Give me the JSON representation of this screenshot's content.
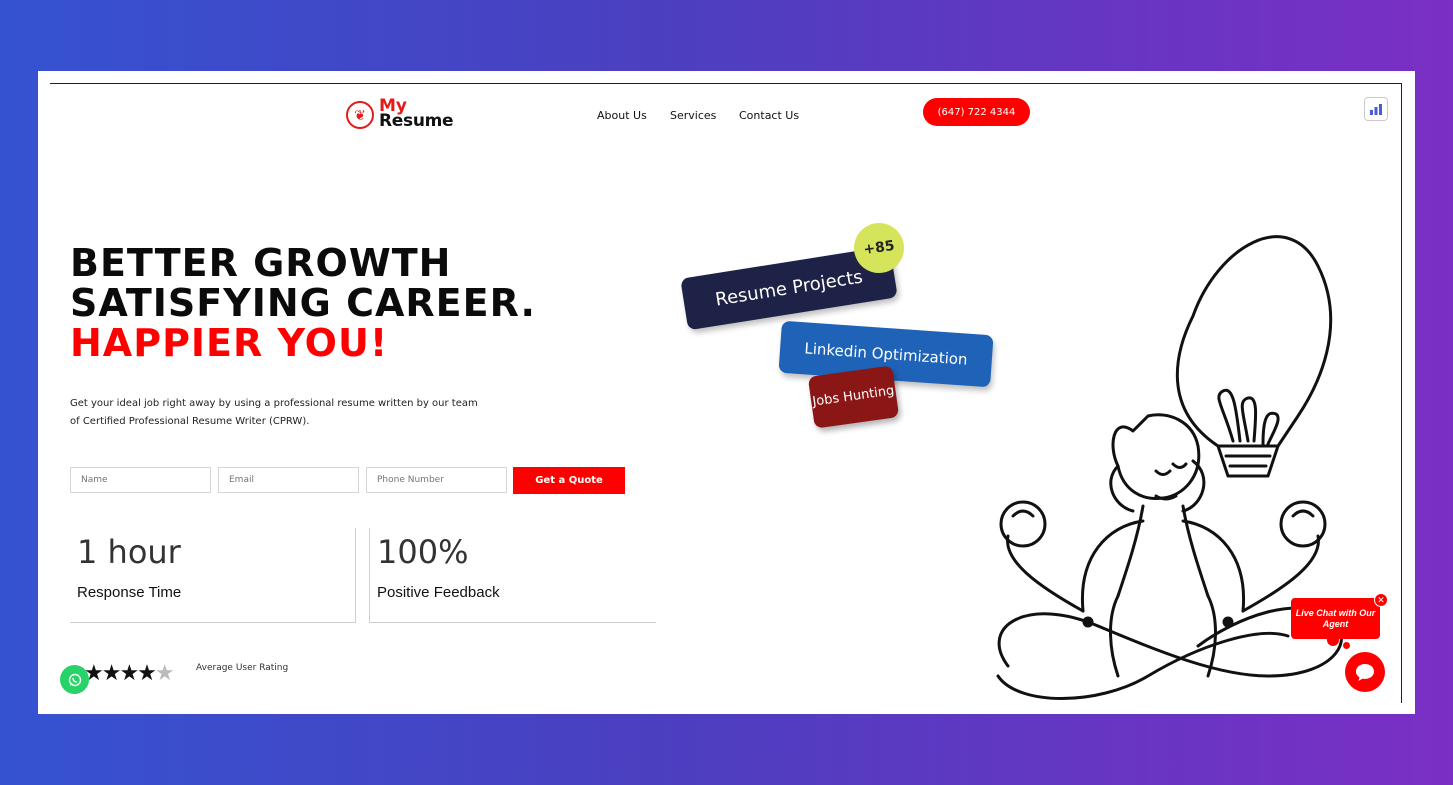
{
  "header": {
    "logo_my": "My",
    "logo_resume": "Resume",
    "nav": [
      "About Us",
      "Services",
      "Contact Us"
    ],
    "phone": "(647) 722 4344"
  },
  "hero": {
    "headline_line1": "BETTER GROWTH",
    "headline_line2": "SATISFYING CAREER.",
    "headline_line3": "HAPPIER YOU!",
    "subtext": "Get your ideal job right away by using a professional resume written by our team of Certified Professional Resume Writer (CPRW)."
  },
  "form": {
    "name_placeholder": "Name",
    "email_placeholder": "Email",
    "phone_placeholder": "Phone Number",
    "submit_label": "Get a Quote"
  },
  "stats": [
    {
      "value": "1 hour",
      "label": "Response Time"
    },
    {
      "value": "100%",
      "label": "Positive Feedback"
    }
  ],
  "rating": {
    "stars": "★★★★",
    "half_star": "★",
    "value": 4.5,
    "label": "Average User Rating"
  },
  "tags": {
    "badge": "+85",
    "projects": "Resume Projects",
    "linkedin": "Linkedin Optimization",
    "jobs": "Jobs Hunting"
  },
  "chat": {
    "bubble": "Live Chat with Our Agent",
    "close": "✕"
  },
  "colors": {
    "accent": "#ff0000",
    "navy": "#1e2247",
    "blue": "#1e63b8",
    "maroon": "#8b1616",
    "lime": "#d5e45a",
    "whatsapp": "#25d366"
  }
}
